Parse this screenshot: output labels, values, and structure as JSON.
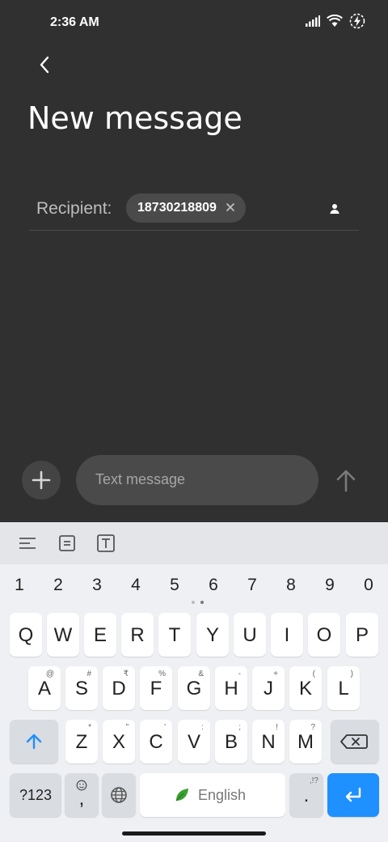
{
  "status_bar": {
    "time": "2:36 AM",
    "icons": [
      "signal-icon",
      "wifi-icon",
      "battery-charging-icon"
    ]
  },
  "header": {
    "title": "New message"
  },
  "recipient": {
    "label": "Recipient:",
    "chip_text": "18730218809"
  },
  "composer": {
    "placeholder": "Text message"
  },
  "keyboard": {
    "numbers": [
      "1",
      "2",
      "3",
      "4",
      "5",
      "6",
      "7",
      "8",
      "9",
      "0"
    ],
    "row1": [
      "Q",
      "W",
      "E",
      "R",
      "T",
      "Y",
      "U",
      "I",
      "O",
      "P"
    ],
    "row2": [
      {
        "k": "A",
        "s": "@"
      },
      {
        "k": "S",
        "s": "#"
      },
      {
        "k": "D",
        "s": "₹"
      },
      {
        "k": "F",
        "s": "%"
      },
      {
        "k": "G",
        "s": "&"
      },
      {
        "k": "H",
        "s": "-"
      },
      {
        "k": "J",
        "s": "+"
      },
      {
        "k": "K",
        "s": "("
      },
      {
        "k": "L",
        "s": ")"
      }
    ],
    "row3": [
      {
        "k": "Z",
        "s": "*"
      },
      {
        "k": "X",
        "s": "\""
      },
      {
        "k": "C",
        "s": "'"
      },
      {
        "k": "V",
        "s": ":"
      },
      {
        "k": "B",
        "s": ";"
      },
      {
        "k": "N",
        "s": "!"
      },
      {
        "k": "M",
        "s": "?"
      }
    ],
    "sym_key": "?123",
    "comma_key": ",",
    "space_label": "English",
    "period_key": ".",
    "period_sub": ",!?"
  },
  "colors": {
    "accent": "#1e90ff",
    "background": "#303030"
  }
}
